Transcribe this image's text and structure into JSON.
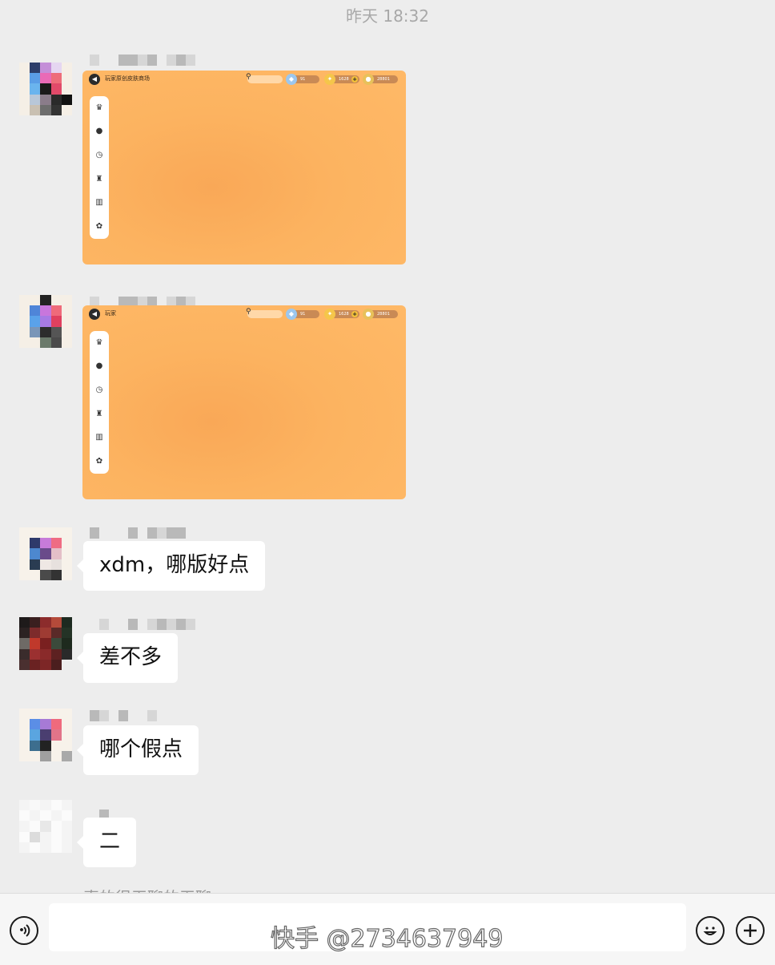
{
  "header": {
    "timestamp": "昨天 18:32"
  },
  "messages": [
    {
      "type": "image",
      "game": {
        "title": "玩家原创皮肤商场",
        "currency_a": "91",
        "currency_b": "1628",
        "currency_c": "28801"
      }
    },
    {
      "type": "image",
      "game": {
        "title": "玩家",
        "currency_a": "91",
        "currency_b": "1628",
        "currency_c": "28801"
      }
    },
    {
      "type": "text",
      "text": "xdm，哪版好点"
    },
    {
      "type": "text",
      "text": "差不多"
    },
    {
      "type": "text",
      "text": "哪个假点"
    },
    {
      "type": "text",
      "text": "二"
    }
  ],
  "partial_message": "真的很无聊的无聊",
  "input_bar": {
    "voice_icon": "voice-icon",
    "emoji_icon": "emoji-icon",
    "plus_icon": "plus-icon"
  },
  "watermark": "快手 @2734637949",
  "colors": {
    "background": "#ededed",
    "bubble": "#ffffff",
    "image_orange": "#fcb360"
  }
}
